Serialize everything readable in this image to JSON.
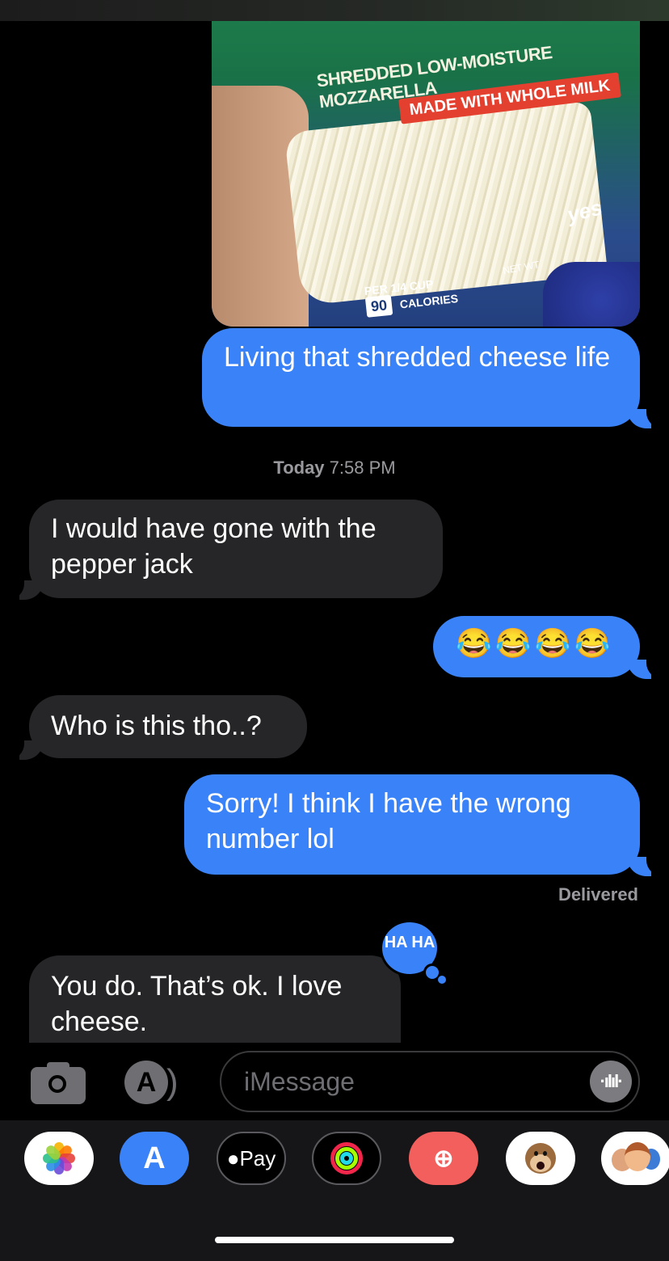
{
  "header": {
    "partial_text": ""
  },
  "photo": {
    "line1": "SHREDDED LOW-MOISTURE MOZZARELLA",
    "line2": "MADE WITH WHOLE MILK",
    "nutrition": "PER 1/4 CUP",
    "calories": "90",
    "calories_label": "CALORIES",
    "net_wt": "NET WT",
    "yes_text": "yes"
  },
  "messages": [
    {
      "direction": "out",
      "text": "Living that shredded cheese life"
    },
    {
      "direction": "in",
      "text": "I would have gone with the pepper jack"
    },
    {
      "direction": "out",
      "text": "😂😂😂😂"
    },
    {
      "direction": "in",
      "text": "Who is this tho..?"
    },
    {
      "direction": "out",
      "text": "Sorry! I think I have the wrong number lol"
    },
    {
      "direction": "in",
      "text": "You do. That’s ok. I love cheese."
    }
  ],
  "timestamp": {
    "day": "Today",
    "time": "7:58 PM"
  },
  "status": "Delivered",
  "tapback": {
    "label": "HA HA"
  },
  "input": {
    "placeholder": "iMessage"
  },
  "drawer": {
    "apps": [
      {
        "name": "photos",
        "icon": "photos-icon"
      },
      {
        "name": "app-store",
        "icon": "app-store-icon"
      },
      {
        "name": "apple-pay",
        "label": "Pay"
      },
      {
        "name": "activity",
        "icon": "activity-rings-icon"
      },
      {
        "name": "web-search",
        "icon": "globe-search-icon"
      },
      {
        "name": "animoji",
        "icon": "monkey-icon"
      },
      {
        "name": "memoji",
        "icon": "memoji-icon"
      }
    ]
  },
  "colors": {
    "outgoing": "#3a82f7",
    "incoming": "#262628",
    "background": "#000000"
  }
}
